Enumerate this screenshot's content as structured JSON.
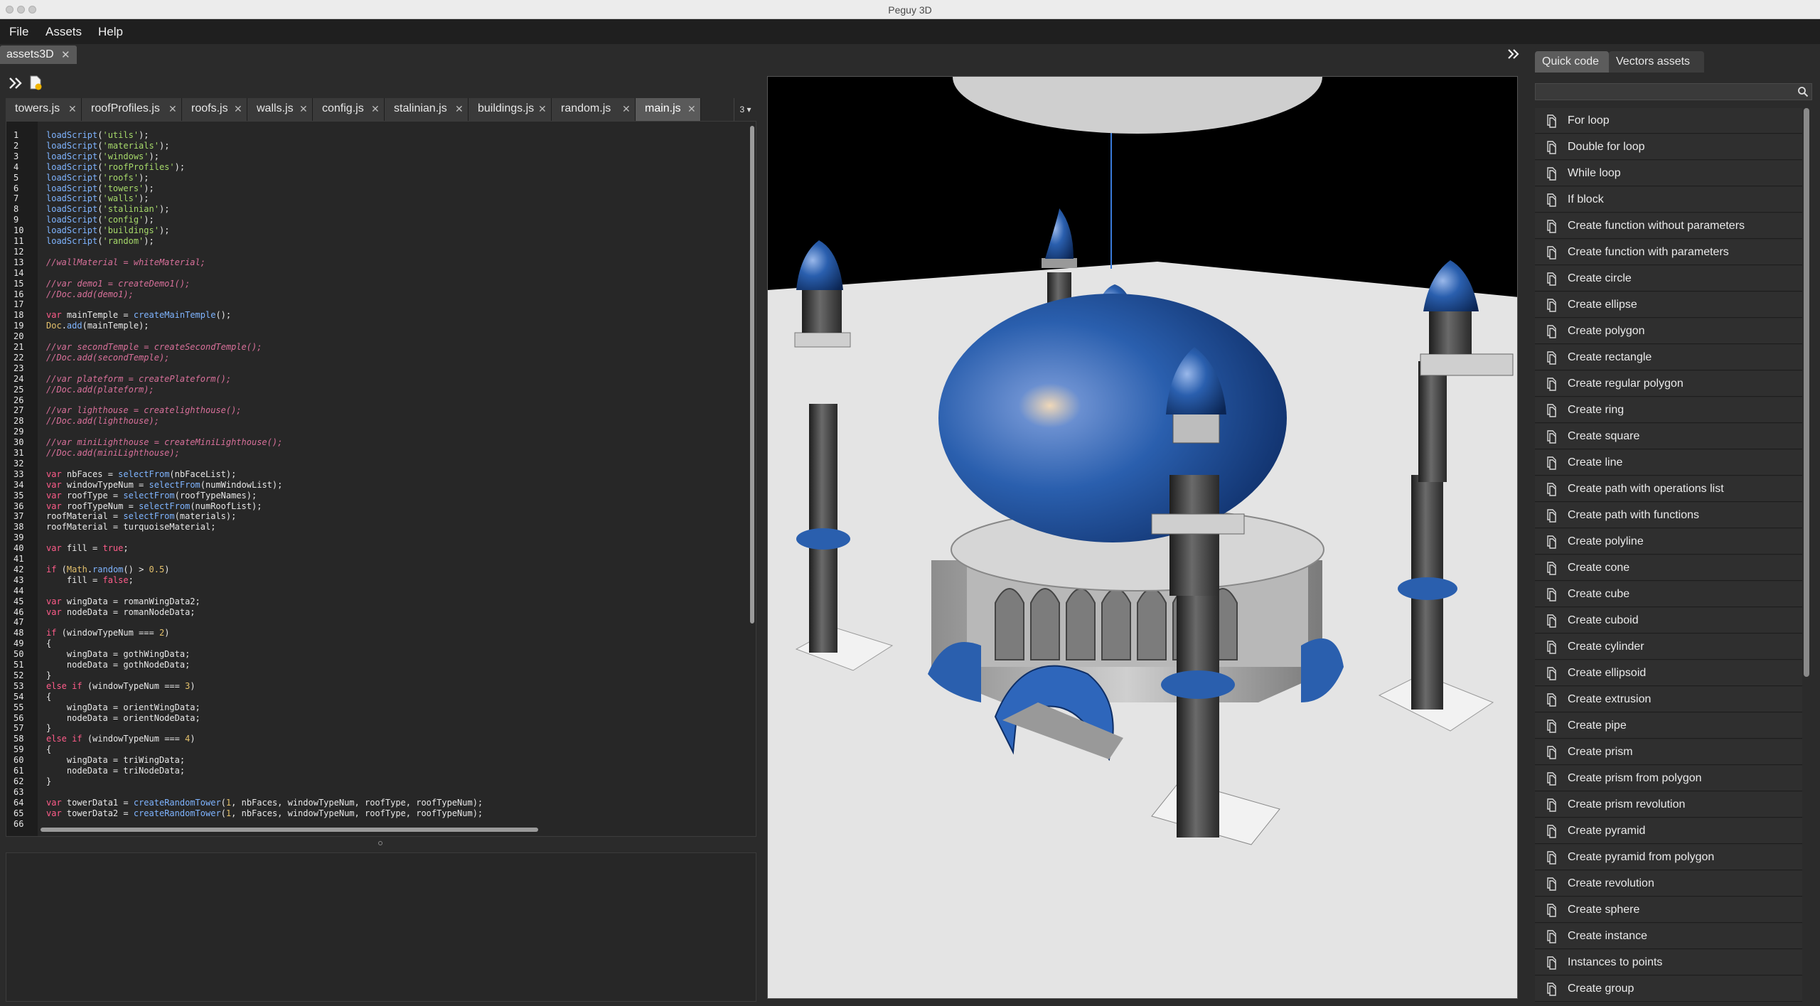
{
  "window": {
    "title": "Peguy 3D"
  },
  "menu": {
    "items": [
      "File",
      "Assets",
      "Help"
    ]
  },
  "doc_tab": {
    "label": "assets3D",
    "close": "✕"
  },
  "editor_tabs": [
    {
      "label": "towers.js"
    },
    {
      "label": "roofProfiles.js"
    },
    {
      "label": "roofs.js"
    },
    {
      "label": "walls.js"
    },
    {
      "label": "config.js"
    },
    {
      "label": "stalinian.js"
    },
    {
      "label": "buildings.js"
    },
    {
      "label": "random.js"
    },
    {
      "label": "main.js",
      "active": true
    }
  ],
  "tab_close": "✕",
  "tab_overflow": "3 ▾",
  "code_lines": [
    "loadScript('utils');",
    "loadScript('materials');",
    "loadScript('windows');",
    "loadScript('roofProfiles');",
    "loadScript('roofs');",
    "loadScript('towers');",
    "loadScript('walls');",
    "loadScript('stalinian');",
    "loadScript('config');",
    "loadScript('buildings');",
    "loadScript('random');",
    "",
    "//wallMaterial = whiteMaterial;",
    "",
    "//var demo1 = createDemo1();",
    "//Doc.add(demo1);",
    "",
    "var mainTemple = createMainTemple();",
    "Doc.add(mainTemple);",
    "",
    "//var secondTemple = createSecondTemple();",
    "//Doc.add(secondTemple);",
    "",
    "//var plateform = createPlateform();",
    "//Doc.add(plateform);",
    "",
    "//var lighthouse = createlighthouse();",
    "//Doc.add(lighthouse);",
    "",
    "//var miniLighthouse = createMiniLighthouse();",
    "//Doc.add(miniLighthouse);",
    "",
    "var nbFaces = selectFrom(nbFaceList);",
    "var windowTypeNum = selectFrom(numWindowList);",
    "var roofType = selectFrom(roofTypeNames);",
    "var roofTypeNum = selectFrom(numRoofList);",
    "roofMaterial = selectFrom(materials);",
    "roofMaterial = turquoiseMaterial;",
    "",
    "var fill = true;",
    "",
    "if (Math.random() > 0.5)",
    "    fill = false;",
    "",
    "var wingData = romanWingData2;",
    "var nodeData = romanNodeData;",
    "",
    "if (windowTypeNum === 2)",
    "{",
    "    wingData = gothWingData;",
    "    nodeData = gothNodeData;",
    "}",
    "else if (windowTypeNum === 3)",
    "{",
    "    wingData = orientWingData;",
    "    nodeData = orientNodeData;",
    "}",
    "else if (windowTypeNum === 4)",
    "{",
    "    wingData = triWingData;",
    "    nodeData = triNodeData;",
    "}",
    "",
    "var towerData1 = createRandomTower(1, nbFaces, windowTypeNum, roofType, roofTypeNum);",
    "var towerData2 = createRandomTower(1, nbFaces, windowTypeNum, roofType, roofTypeNum);",
    ""
  ],
  "right_panel": {
    "tabs": [
      {
        "label": "Quick code",
        "active": true
      },
      {
        "label": "Vectors assets"
      }
    ],
    "search_placeholder": "",
    "items": [
      "For loop",
      "Double for loop",
      "While loop",
      "If block",
      "Create function without parameters",
      "Create function with parameters",
      "Create circle",
      "Create ellipse",
      "Create polygon",
      "Create rectangle",
      "Create regular polygon",
      "Create ring",
      "Create square",
      "Create line",
      "Create path with operations list",
      "Create path with functions",
      "Create polyline",
      "Create cone",
      "Create cube",
      "Create cuboid",
      "Create cylinder",
      "Create ellipsoid",
      "Create extrusion",
      "Create pipe",
      "Create prism",
      "Create prism from polygon",
      "Create prism revolution",
      "Create pyramid",
      "Create pyramid from polygon",
      "Create revolution",
      "Create sphere",
      "Create instance",
      "Instances to points",
      "Create group"
    ]
  },
  "colors": {
    "background": "#2b2b2b",
    "editor_bg": "#272727",
    "string": "#a6d96a",
    "function": "#7fb4ff",
    "comment": "#d8709a",
    "keyword": "#ff5c8a",
    "number": "#e3c06b",
    "dome_blue": "#2a5fae",
    "sky": "#000000",
    "ground": "#e4e4e4"
  }
}
